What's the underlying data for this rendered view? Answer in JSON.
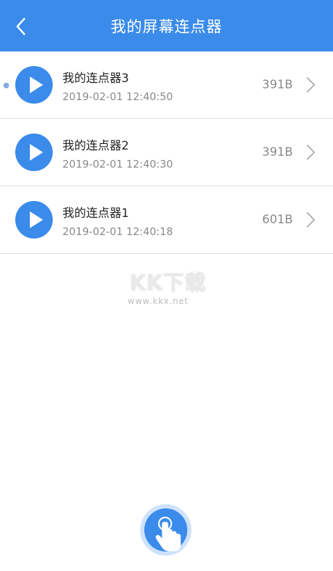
{
  "header": {
    "title": "我的屏幕连点器"
  },
  "list": {
    "items": [
      {
        "name": "我的连点器3",
        "time": "2019-02-01 12:40:50",
        "size": "391B",
        "selected": true
      },
      {
        "name": "我的连点器2",
        "time": "2019-02-01 12:40:30",
        "size": "391B",
        "selected": false
      },
      {
        "name": "我的连点器1",
        "time": "2019-02-01 12:40:18",
        "size": "601B",
        "selected": false
      }
    ]
  },
  "watermark": {
    "logo": "KK下载",
    "url": "www.kkx.net"
  },
  "icons": {
    "back": "chevron-left-icon",
    "play": "play-icon",
    "chevron": "chevron-right-icon",
    "fab": "finger-touch-icon"
  },
  "colors": {
    "header_bg": "#3a8bea",
    "accent": "#3a8bea",
    "text_primary": "#222222",
    "text_secondary": "#8a8a8a",
    "selected_dot": "#7fa8e6"
  }
}
